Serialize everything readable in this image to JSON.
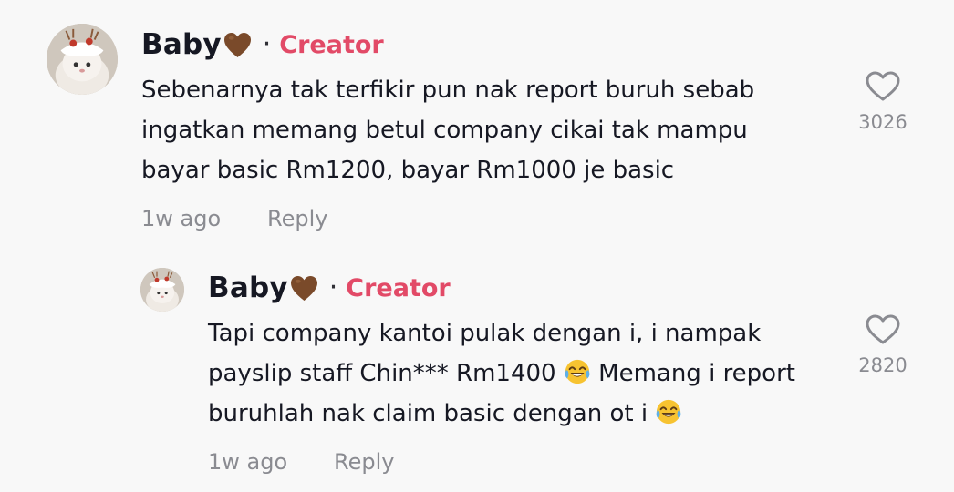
{
  "comments": [
    {
      "username": "Baby",
      "username_suffix_emoji": "brown-heart",
      "badge": "Creator",
      "separator": "·",
      "lines": [
        "Sebenarnya tak terfikir pun nak report buruh sebab",
        "ingatkan memang betul company cikai tak mampu",
        "bayar basic Rm1200, bayar Rm1000 je basic"
      ],
      "time": "1w ago",
      "reply_label": "Reply",
      "like_count": "3026"
    },
    {
      "username": "Baby",
      "username_suffix_emoji": "brown-heart",
      "badge": "Creator",
      "separator": "·",
      "lines": [
        "Tapi company kantoi pulak dengan i, i nampak",
        "payslip staff Chin*** Rm1400",
        "Memang i report",
        "buruhlah nak claim basic dengan ot i"
      ],
      "time": "1w ago",
      "reply_label": "Reply",
      "like_count": "2820"
    }
  ],
  "colors": {
    "background": "#f8f8f8",
    "creator_badge": "#e24a67",
    "text_primary": "#161823",
    "text_secondary": "#8a8b91"
  },
  "icons": {
    "like": "heart-outline-icon",
    "inline_emoji": "face-with-tears-of-joy",
    "name_emoji": "brown-heart"
  }
}
